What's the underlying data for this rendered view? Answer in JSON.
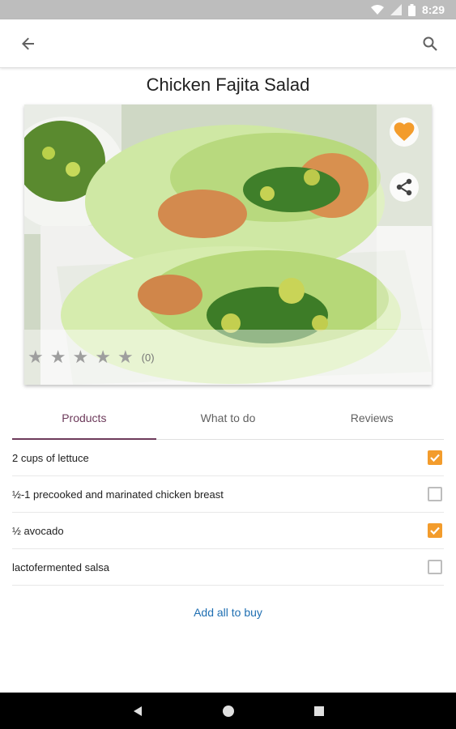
{
  "status_bar": {
    "time": "8:29"
  },
  "app_bar": {
    "back_icon": "arrow-back-icon",
    "search_icon": "search-icon"
  },
  "recipe": {
    "title": "Chicken Fajita Salad",
    "rating": {
      "stars_filled": 0,
      "stars_total": 5,
      "count_label": "(0)"
    },
    "favorite_icon": "heart-icon",
    "share_icon": "share-icon"
  },
  "colors": {
    "accent": "#6d3b5b",
    "checkbox": "#f39c2c",
    "link": "#1f6fb2"
  },
  "tabs": [
    {
      "label": "Products",
      "active": true
    },
    {
      "label": "What to do",
      "active": false
    },
    {
      "label": "Reviews",
      "active": false
    }
  ],
  "products": [
    {
      "text": "2 cups of lettuce",
      "checked": true
    },
    {
      "text": "½-1 precooked and marinated chicken breast",
      "checked": false
    },
    {
      "text": "½ avocado",
      "checked": true
    },
    {
      "text": "lactofermented salsa",
      "checked": false
    }
  ],
  "add_all_label": "Add all to buy",
  "nav": {
    "back_icon": "nav-back-icon",
    "home_icon": "nav-home-icon",
    "recents_icon": "nav-recents-icon"
  }
}
